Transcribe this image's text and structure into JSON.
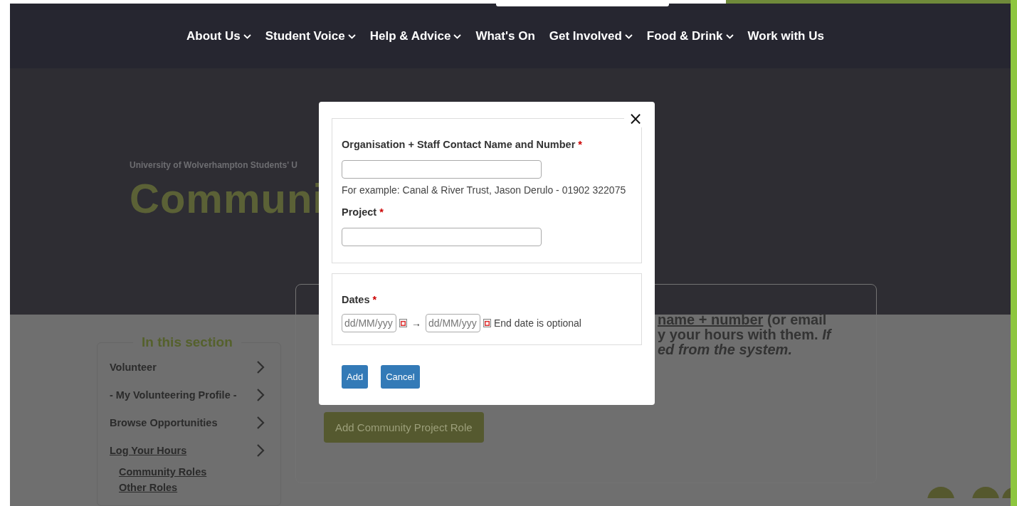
{
  "nav": [
    {
      "label": "About Us",
      "dropdown": true
    },
    {
      "label": "Student Voice",
      "dropdown": true
    },
    {
      "label": "Help & Advice",
      "dropdown": true
    },
    {
      "label": "What's On",
      "dropdown": false
    },
    {
      "label": "Get Involved",
      "dropdown": true
    },
    {
      "label": "Food & Drink",
      "dropdown": true
    },
    {
      "label": "Work with Us",
      "dropdown": false
    }
  ],
  "hero": {
    "breadcrumb": "University of Wolverhampton Students' U",
    "title": "Communi"
  },
  "sidebar": {
    "legend": "In this section",
    "items": [
      {
        "label": "Volunteer",
        "current": false
      },
      {
        "label": "- My Volunteering Profile -",
        "current": false
      },
      {
        "label": "Browse Opportunities",
        "current": false
      },
      {
        "label": "Log Your Hours",
        "current": true,
        "children": [
          {
            "label": "Community Roles"
          },
          {
            "label": "Other Roles"
          }
        ]
      }
    ]
  },
  "card": {
    "lines": [
      {
        "kind": "link",
        "link": "name + number",
        "text": " (or email"
      },
      {
        "kind": "plain",
        "text": "y your hours with them. *If*"
      },
      {
        "kind": "italic",
        "text": "ed from the system."
      }
    ],
    "add_button": "Add Community Project Role"
  },
  "modal": {
    "close": "×",
    "org_label": "Organisation + Staff Contact Name and Number",
    "org_required_mark": "*",
    "org_hint": "For example: Canal & River Trust, Jason Derulo - 01902 322075",
    "project_label": "Project",
    "project_required_mark": "*",
    "dates_label": "Dates",
    "dates_required_mark": "*",
    "start_placeholder": "dd/MM/yyy",
    "arrow": "→",
    "end_placeholder": "dd/MM/yyy",
    "end_note": "End date is optional",
    "buttons": [
      "Add",
      "Cancel"
    ]
  }
}
